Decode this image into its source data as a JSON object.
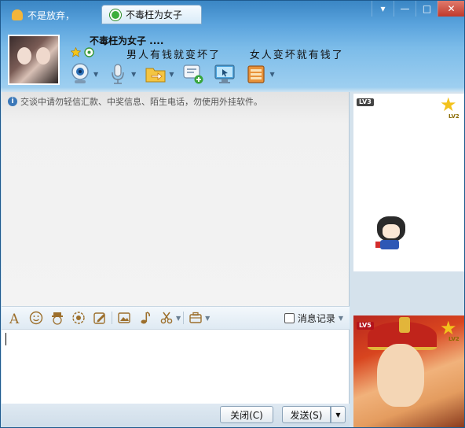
{
  "tabs": [
    {
      "label": "不是放弃，"
    },
    {
      "label": "不毒枉为女子"
    }
  ],
  "window_controls": {
    "menu": "▾",
    "minimize": "—",
    "maximize": "□",
    "close": "✕"
  },
  "header": {
    "nickname": "不毒枉为女子 ....",
    "signature": "男人有钱就变坏了      女人变坏就有钱了"
  },
  "toolbar": {
    "icons": [
      "webcam-icon",
      "microphone-icon",
      "file-transfer-icon",
      "create-discussion-icon",
      "remote-assist-icon",
      "apps-icon"
    ]
  },
  "chat": {
    "notice": "交谈中请勿轻信汇款、中奖信息、陌生电话，勿使用外挂软件。"
  },
  "input_toolbar": {
    "history_label": "消息记录"
  },
  "buttons": {
    "close": "关闭(C)",
    "send": "发送(S)"
  },
  "right_panel": {
    "top_level": "LV3",
    "top_star_level": "LV2",
    "bottom_level": "LV5",
    "bottom_star_level": "LV2"
  }
}
